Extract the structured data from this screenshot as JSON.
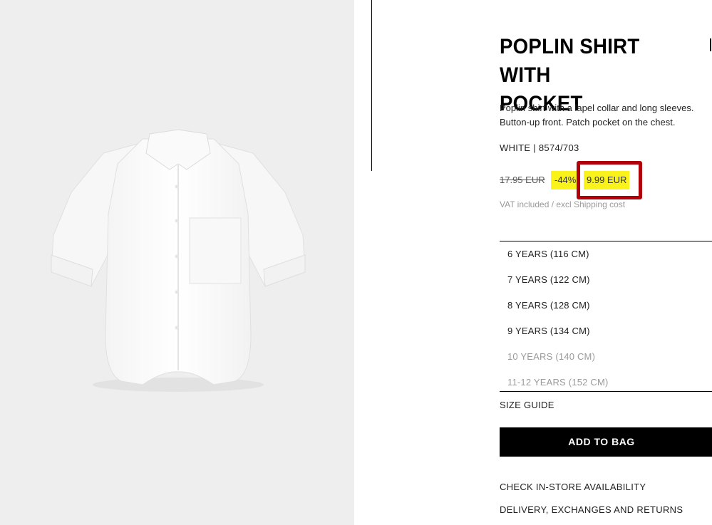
{
  "product": {
    "title_line1": "POPLIN SHIRT WITH",
    "title_line2": "POCKET",
    "description_line1": "Poplin shirt with a lapel collar and long sleeves.",
    "description_line2": "Button-up front. Patch pocket on the chest.",
    "color_ref": "WHITE | 8574/703",
    "old_price": "17.95 EUR",
    "discount": "-44%",
    "new_price": "9.99 EUR",
    "vat_note": "VAT included / excl Shipping cost"
  },
  "sizes": [
    {
      "label": "6 YEARS (116 CM)",
      "available": true
    },
    {
      "label": "7 YEARS (122 CM)",
      "available": true
    },
    {
      "label": "8 YEARS (128 CM)",
      "available": true
    },
    {
      "label": "9 YEARS (134 CM)",
      "available": true
    },
    {
      "label": "10 YEARS (140 CM)",
      "available": false
    },
    {
      "label": "11-12 YEARS (152 CM)",
      "available": false
    }
  ],
  "size_guide": "SIZE GUIDE",
  "add_to_bag": "ADD TO BAG",
  "links": {
    "check_store": "CHECK IN-STORE AVAILABILITY",
    "delivery": "DELIVERY, EXCHANGES AND RETURNS"
  },
  "colors": {
    "highlight": "#f9f21b",
    "annotation_box": "#b0000a",
    "image_background": "#eeeeee"
  }
}
